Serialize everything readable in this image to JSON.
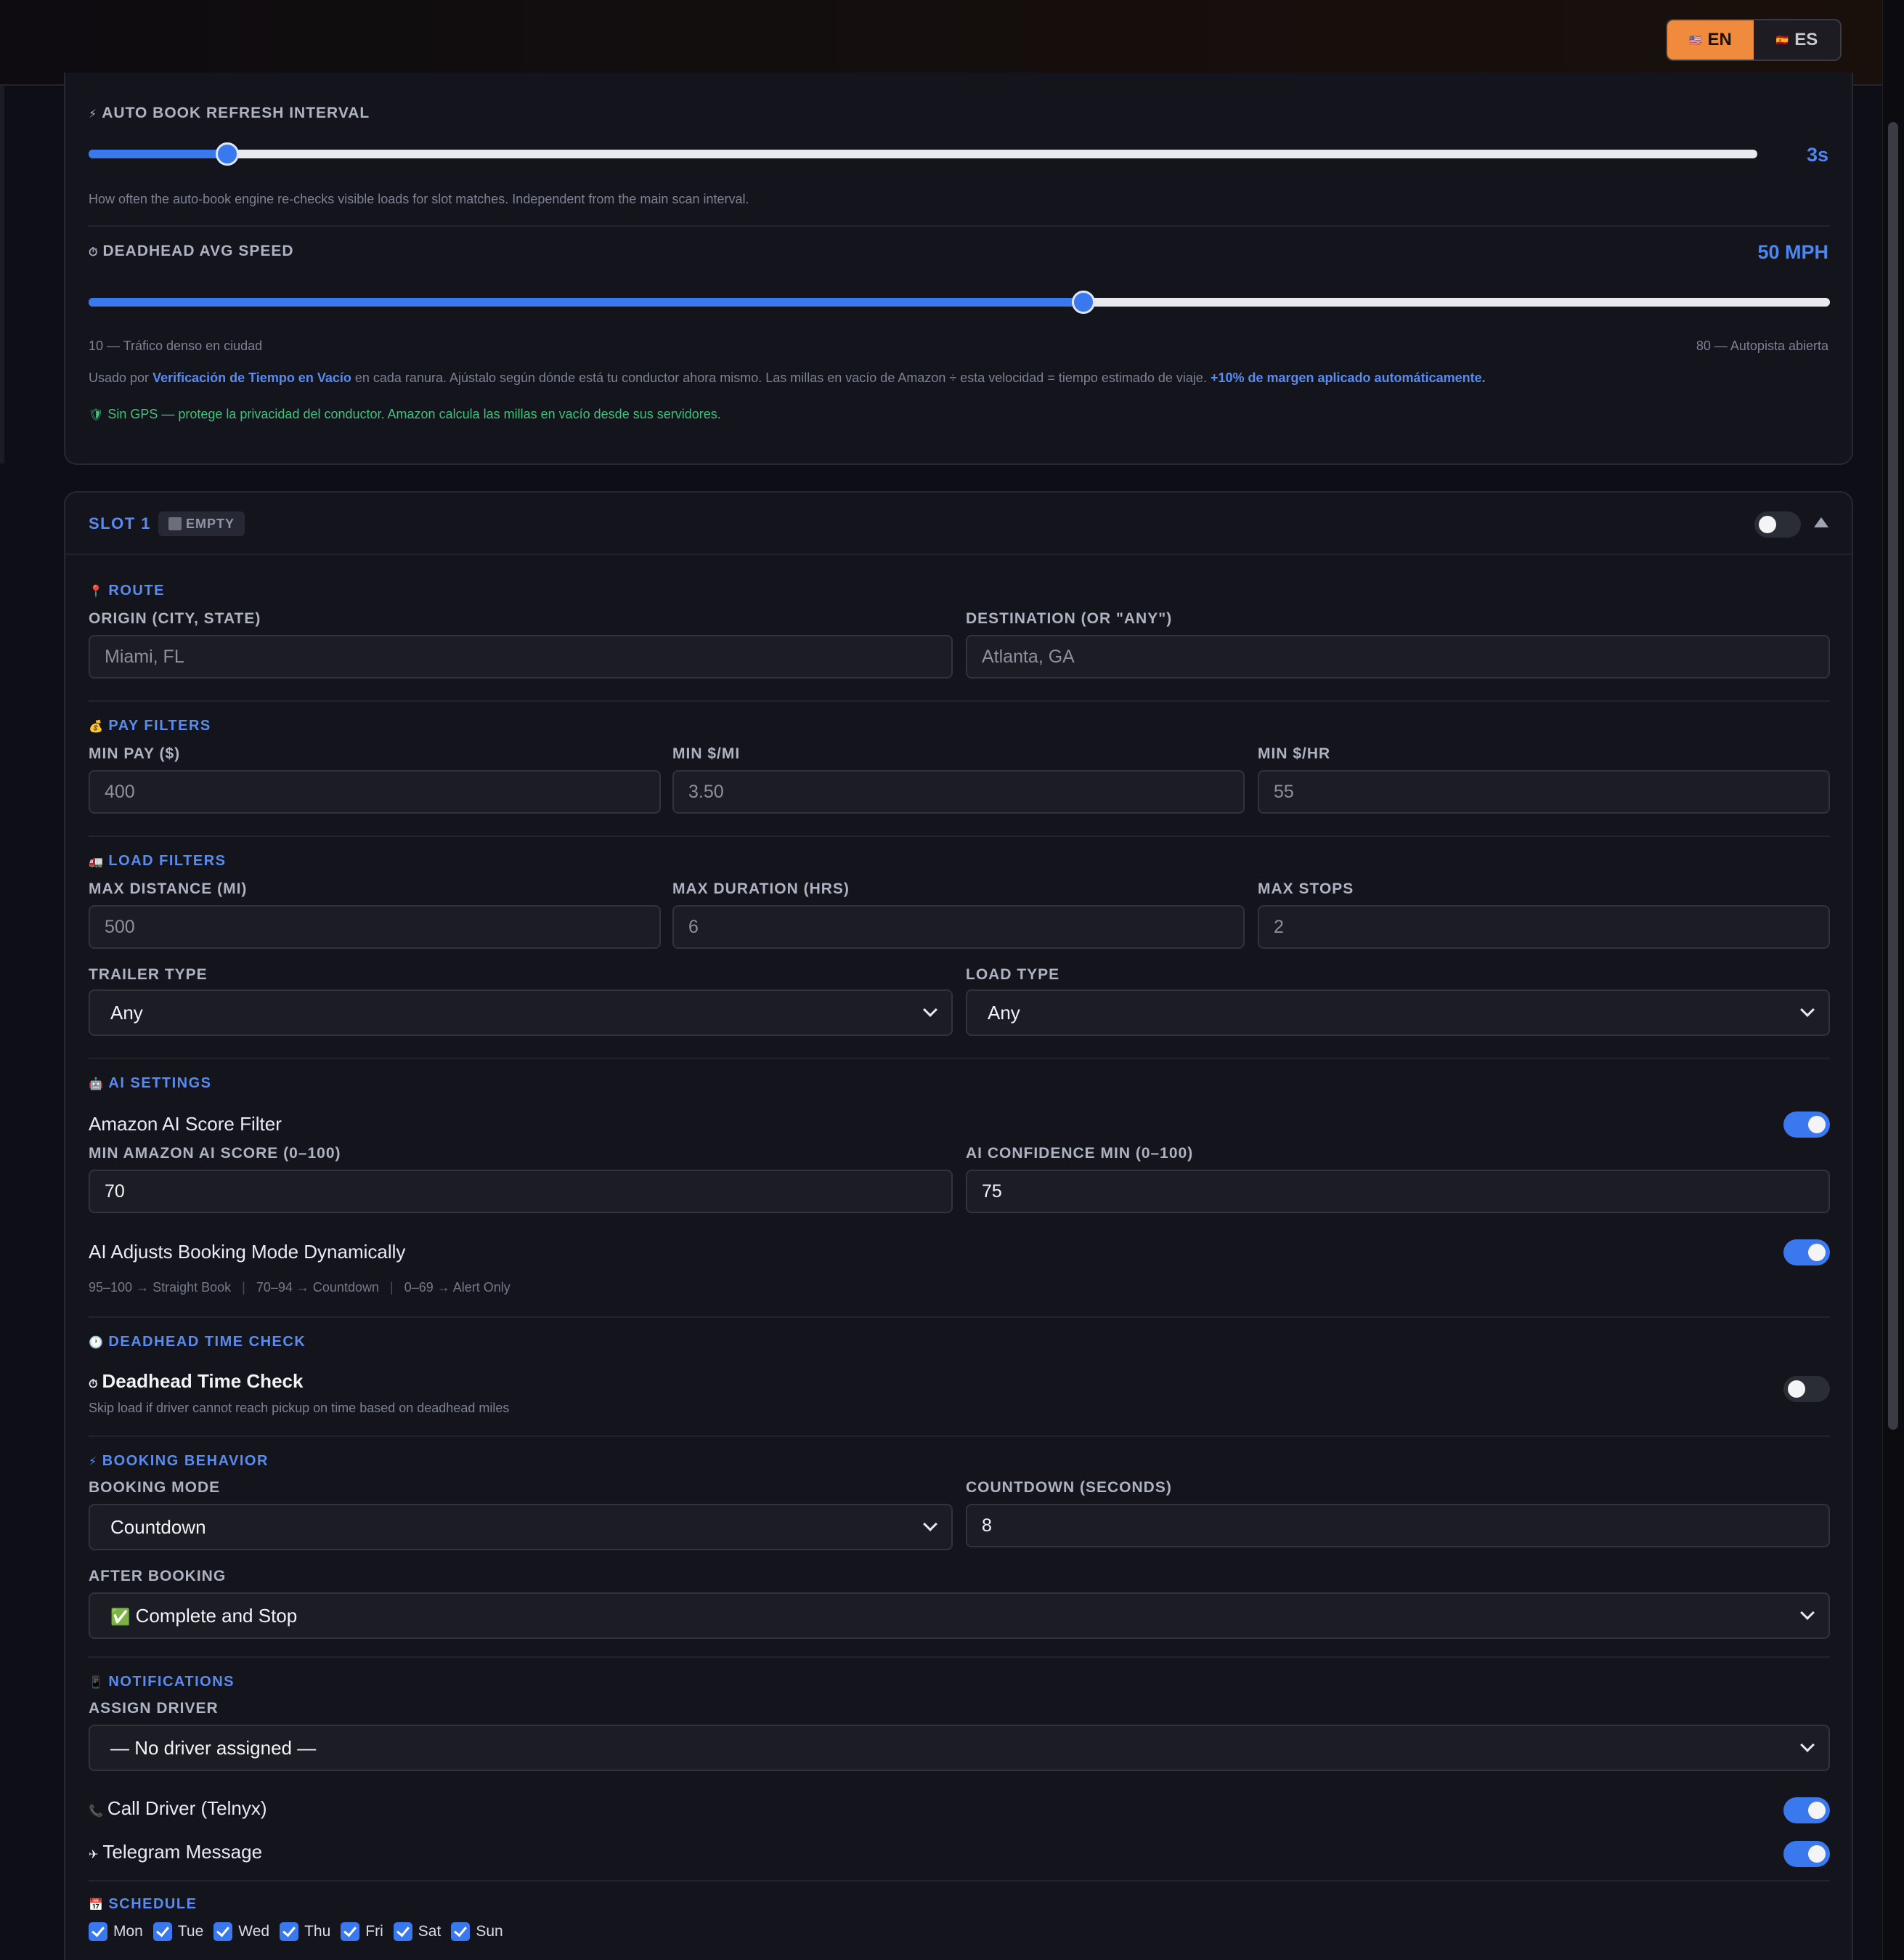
{
  "lang": {
    "en": "EN",
    "es": "ES"
  },
  "autobook": {
    "title": "AUTO BOOK REFRESH INTERVAL",
    "value": "3s",
    "level": 0.083,
    "help": "How often the auto-book engine re-checks visible loads for slot matches. Independent from the main scan interval."
  },
  "deadhead_speed": {
    "title": "DEADHEAD AVG SPEED",
    "value": "50 MPH",
    "level": 0.571,
    "min_label": "10 — Tráfico denso en ciudad",
    "max_label": "80 — Autopista abierta",
    "note_pre": "Usado por",
    "note_link": "Verificación de Tiempo en Vacío",
    "note_mid": "en cada ranura. Ajústalo según dónde está tu conductor ahora mismo. Las millas en vacío de Amazon ÷ esta velocidad = tiempo estimado de viaje.",
    "note_bold": "+10% de margen aplicado automáticamente.",
    "gps_note": "Sin GPS — protege la privacidad del conductor. Amazon calcula las millas en vacío desde sus servidores."
  },
  "slot": {
    "title": "SLOT 1",
    "badge": "EMPTY",
    "enabled": false,
    "route": {
      "title": "ROUTE",
      "origin_label": "ORIGIN (CITY, STATE)",
      "origin_placeholder": "Miami, FL",
      "dest_label": "DESTINATION (OR \"ANY\")",
      "dest_placeholder": "Atlanta, GA"
    },
    "pay": {
      "title": "PAY FILTERS",
      "min_pay_label": "MIN PAY ($)",
      "min_pay_placeholder": "400",
      "min_mi_label": "MIN $/MI",
      "min_mi_placeholder": "3.50",
      "min_hr_label": "MIN $/HR",
      "min_hr_placeholder": "55"
    },
    "load": {
      "title": "LOAD FILTERS",
      "max_dist_label": "MAX DISTANCE (MI)",
      "max_dist_placeholder": "500",
      "max_dur_label": "MAX DURATION (HRS)",
      "max_dur_placeholder": "6",
      "max_stops_label": "MAX STOPS",
      "max_stops_placeholder": "2",
      "trailer_label": "TRAILER TYPE",
      "trailer_value": "Any",
      "loadtype_label": "LOAD TYPE",
      "loadtype_value": "Any"
    },
    "ai": {
      "title": "AI SETTINGS",
      "filter_label": "Amazon AI Score Filter",
      "filter_on": true,
      "min_score_label": "MIN AMAZON AI SCORE (0–100)",
      "min_score_value": "70",
      "conf_label": "AI CONFIDENCE MIN (0–100)",
      "conf_value": "75",
      "dynamic_label": "AI Adjusts Booking Mode Dynamically",
      "dynamic_on": true,
      "tiers": [
        "95–100 → Straight Book",
        "70–94 → Countdown",
        "0–69 → Alert Only"
      ]
    },
    "deadhead": {
      "title": "DEADHEAD TIME CHECK",
      "label": "Deadhead Time Check",
      "help": "Skip load if driver cannot reach pickup on time based on deadhead miles",
      "on": false
    },
    "booking": {
      "title": "BOOKING BEHAVIOR",
      "mode_label": "BOOKING MODE",
      "mode_value": "Countdown",
      "countdown_label": "COUNTDOWN (SECONDS)",
      "countdown_value": "8",
      "after_label": "AFTER BOOKING",
      "after_value": "Complete and Stop"
    },
    "notifications": {
      "title": "NOTIFICATIONS",
      "driver_label": "ASSIGN DRIVER",
      "driver_value": "— No driver assigned —",
      "call_label": "Call Driver (Telnyx)",
      "call_on": true,
      "telegram_label": "Telegram Message",
      "telegram_on": true
    },
    "schedule": {
      "title": "SCHEDULE",
      "days": [
        "Mon",
        "Tue",
        "Wed",
        "Thu",
        "Fri",
        "Sat",
        "Sun"
      ]
    }
  },
  "colors": {
    "accent": "#3a78ee",
    "orange": "#f08a3c",
    "green": "#44c07a"
  }
}
